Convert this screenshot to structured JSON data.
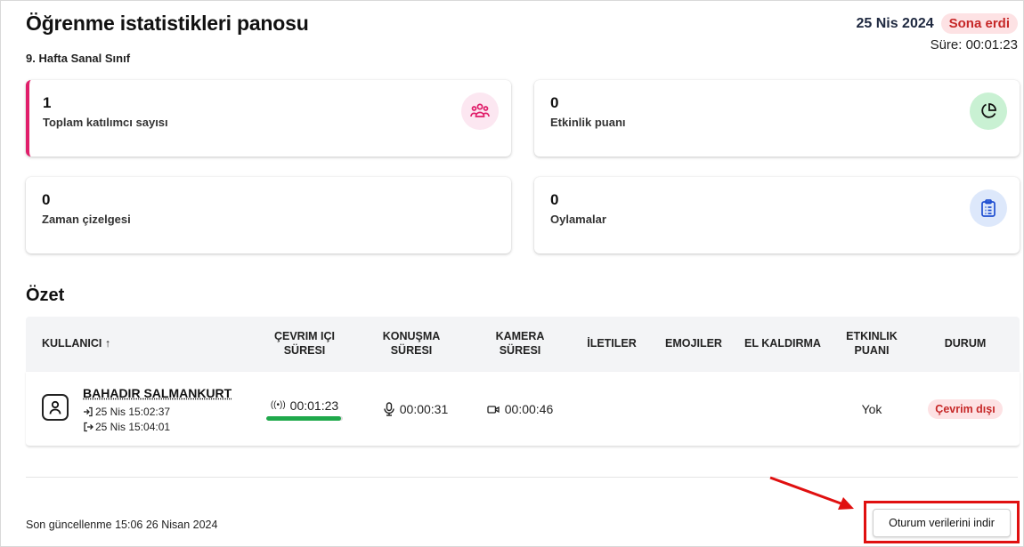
{
  "header": {
    "title": "Öğrenme istatistikleri panosu",
    "subtitle": "9. Hafta Sanal Sınıf",
    "date": "25 Nis 2024",
    "status": "Sona erdi",
    "duration": "Süre: 00:01:23"
  },
  "cards": [
    {
      "value": "1",
      "label": "Toplam katılımcı sayısı",
      "icon": "participants-icon"
    },
    {
      "value": "0",
      "label": "Etkinlik puanı",
      "icon": "pie-chart-icon"
    },
    {
      "value": "0",
      "label": "Zaman çizelgesi"
    },
    {
      "value": "0",
      "label": "Oylamalar",
      "icon": "clipboard-list-icon"
    }
  ],
  "summary": {
    "title": "Özet",
    "columns": {
      "user": "KULLANICI ↑",
      "online_time": "ÇEVRIM IÇI SÜRESI",
      "speaking_time": "KONUŞMA SÜRESI",
      "camera_time": "KAMERA SÜRESI",
      "messages": "İLETILER",
      "emojis": "EMOJILER",
      "hand_raise": "EL KALDIRMA",
      "activity_score": "ETKINLIK PUANI",
      "status": "DURUM"
    },
    "rows": [
      {
        "name": "BAHADIR SALMANKURT",
        "joined": "25 Nis 15:02:37",
        "left": "25 Nis 15:04:01",
        "online_time": "00:01:23",
        "online_progress": 0.98,
        "speaking_time": "00:00:31",
        "camera_time": "00:00:46",
        "messages": "",
        "emojis": "",
        "hand_raise": "",
        "activity_score": "Yok",
        "status": "Çevrim dışı"
      }
    ]
  },
  "footer": {
    "last_updated": "Son güncellenme 15:06 26 Nisan 2024",
    "download_label": "Oturum verilerini indir"
  },
  "colors": {
    "accent_pink": "#e01e6a",
    "status_red": "#c62828",
    "progress_green": "#1fa94b",
    "highlight_red": "#e01010"
  }
}
